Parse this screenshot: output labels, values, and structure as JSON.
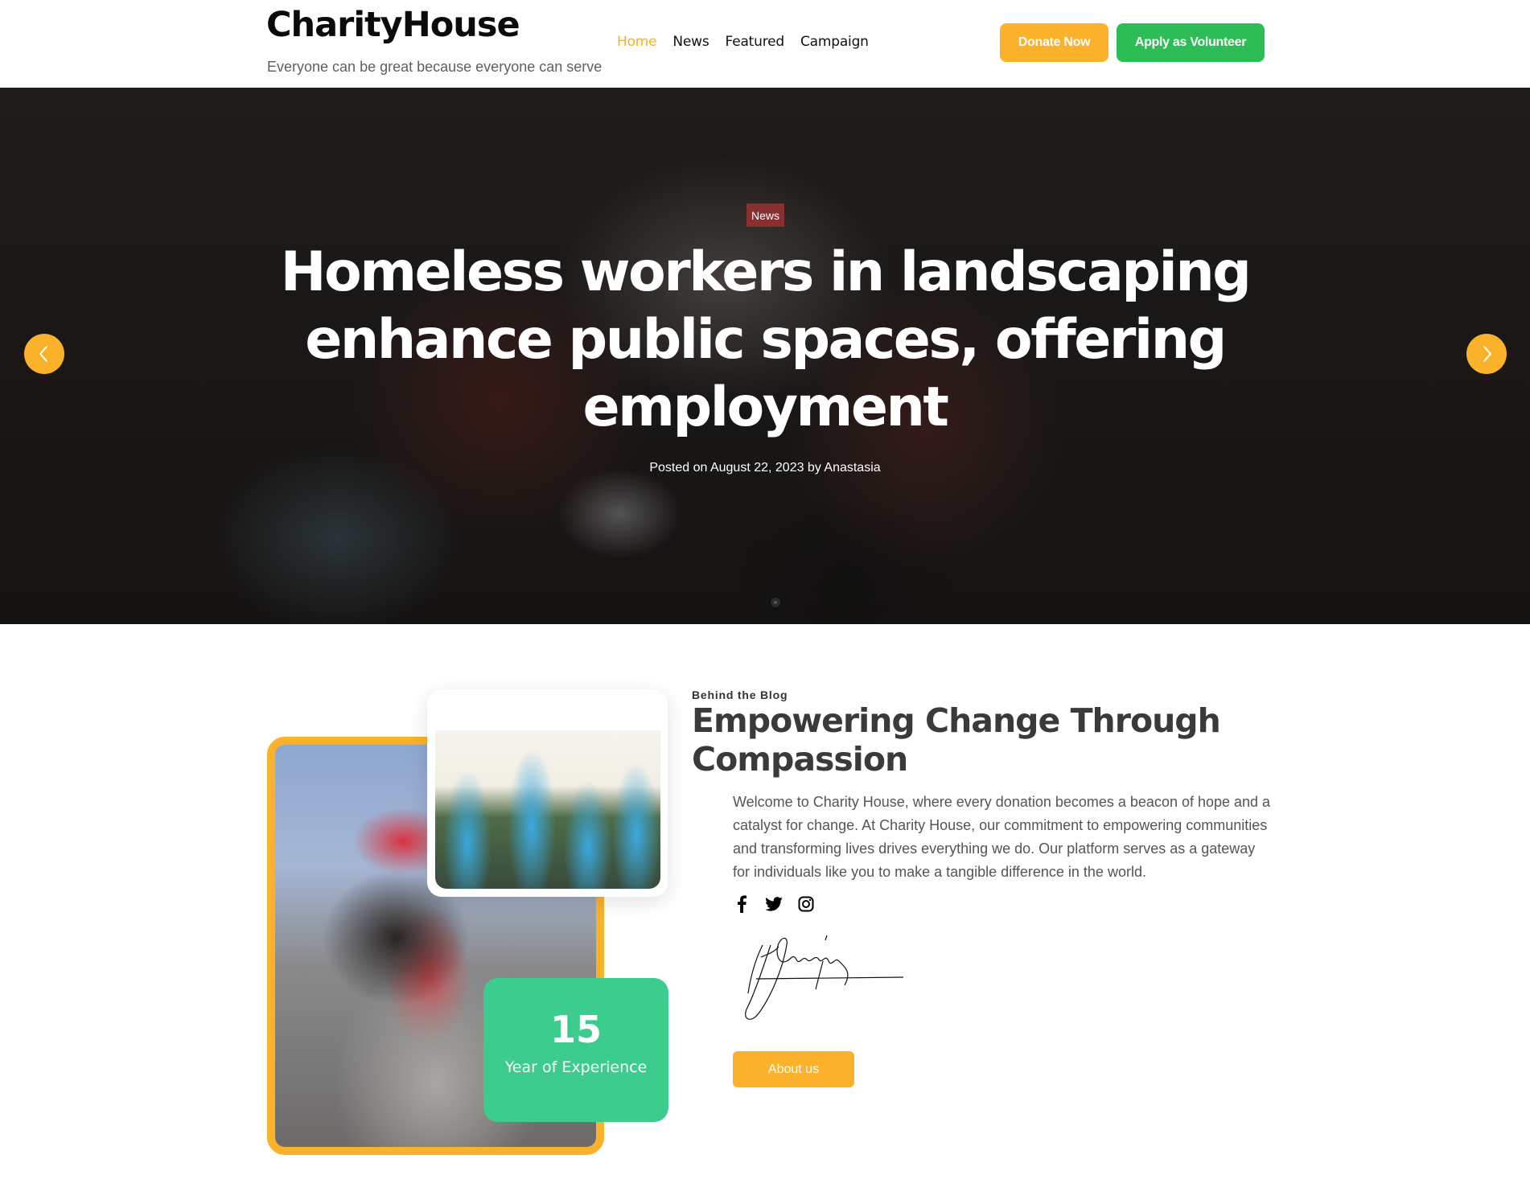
{
  "header": {
    "logo": "CharityHouse",
    "tagline": "Everyone can be great because everyone can serve",
    "nav": [
      {
        "label": "Home",
        "active": true
      },
      {
        "label": "News",
        "active": false
      },
      {
        "label": "Featured",
        "active": false
      },
      {
        "label": "Campaign",
        "active": false
      }
    ],
    "donate_label": "Donate Now",
    "volunteer_label": "Apply as Volunteer"
  },
  "hero": {
    "category": "News",
    "title": "Homeless workers in landscaping enhance public spaces, offering employment",
    "meta": "Posted on August 22, 2023 by Anastasia",
    "prev_icon": "chevron-left-icon",
    "next_icon": "chevron-right-icon",
    "slide_count": 1,
    "active_slide": 1
  },
  "about": {
    "eyebrow": "Behind the Blog",
    "title": "Empowering Change Through Compassion",
    "paragraph": "Welcome to Charity House, where every donation becomes a beacon of hope and a catalyst for change. At Charity House, our commitment to empowering communities and transforming lives drives everything we do. Our platform serves as a gateway for individuals like you to make a tangible difference in the world.",
    "social": [
      "facebook-icon",
      "twitter-icon",
      "instagram-icon"
    ],
    "experience_number": "15",
    "experience_label": "Year of Experience",
    "button_label": "About us"
  },
  "colors": {
    "accent": "#fbb12a",
    "volunteer_green": "#2dbd57",
    "experience_green": "#3ccd8e",
    "badge_red": "#8a2f30",
    "nav_active": "#f5b12c"
  }
}
